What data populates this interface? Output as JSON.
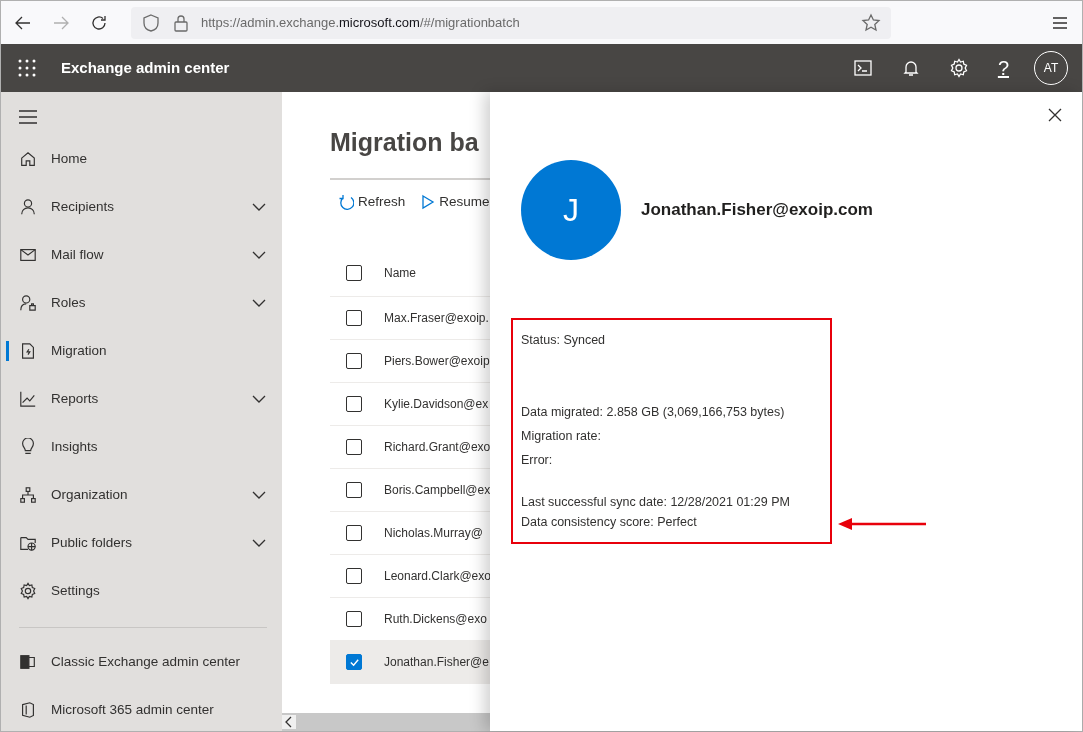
{
  "browser": {
    "url": {
      "before": "https://admin.exchange.",
      "domain": "microsoft.com",
      "after": "/#/migrationbatch"
    }
  },
  "app_header": {
    "title": "Exchange admin center",
    "help": "?",
    "avatar": "AT"
  },
  "sidebar": {
    "items": [
      {
        "label": "Home",
        "expandable": false,
        "selected": false
      },
      {
        "label": "Recipients",
        "expandable": true,
        "selected": false
      },
      {
        "label": "Mail flow",
        "expandable": true,
        "selected": false
      },
      {
        "label": "Roles",
        "expandable": true,
        "selected": false
      },
      {
        "label": "Migration",
        "expandable": false,
        "selected": true
      },
      {
        "label": "Reports",
        "expandable": true,
        "selected": false
      },
      {
        "label": "Insights",
        "expandable": false,
        "selected": false
      },
      {
        "label": "Organization",
        "expandable": true,
        "selected": false
      },
      {
        "label": "Public folders",
        "expandable": true,
        "selected": false
      },
      {
        "label": "Settings",
        "expandable": false,
        "selected": false
      }
    ],
    "footer_links": [
      "Classic Exchange admin center",
      "Microsoft 365 admin center"
    ]
  },
  "main": {
    "title": "Migration ba",
    "toolbar": [
      "Refresh",
      "Resume"
    ],
    "table": {
      "columns": [
        "Name"
      ],
      "header_checked": false,
      "rows": [
        {
          "name": "Max.Fraser@exoip.",
          "selected": false
        },
        {
          "name": "Piers.Bower@exoip",
          "selected": false
        },
        {
          "name": "Kylie.Davidson@ex",
          "selected": false
        },
        {
          "name": "Richard.Grant@exo",
          "selected": false
        },
        {
          "name": "Boris.Campbell@ex",
          "selected": false
        },
        {
          "name": "Nicholas.Murray@",
          "selected": false
        },
        {
          "name": "Leonard.Clark@exo",
          "selected": false
        },
        {
          "name": "Ruth.Dickens@exo",
          "selected": false
        },
        {
          "name": "Jonathan.Fisher@e",
          "selected": true
        }
      ]
    }
  },
  "panel": {
    "avatar": "J",
    "name": "Jonathan.Fisher@exoip.com",
    "details": [
      [
        "Status: Synced"
      ],
      [
        "Data migrated: 2.858 GB (3,069,166,753 bytes)",
        "Migration rate:",
        "Error:"
      ],
      [
        "Last successful sync date: 12/28/2021 01:29 PM",
        "Data consistency score: Perfect"
      ]
    ]
  }
}
